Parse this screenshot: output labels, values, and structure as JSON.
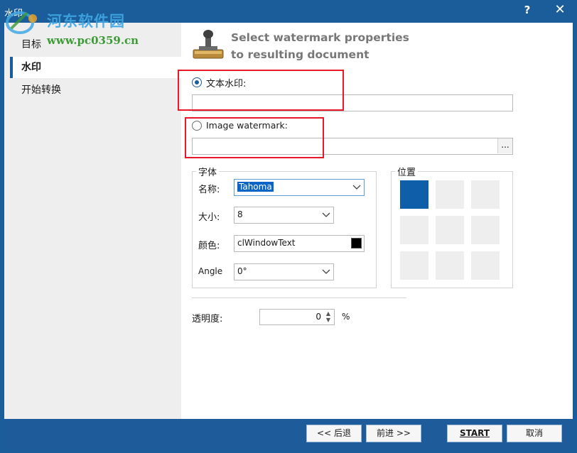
{
  "window": {
    "title": "水印",
    "help_label": "?",
    "close_label": "✕"
  },
  "overlay_watermark": {
    "name": "河东软件园",
    "url": "www.pc0359.cn"
  },
  "sidebar": {
    "items": [
      {
        "label": "目标",
        "active": false
      },
      {
        "label": "水印",
        "active": true
      },
      {
        "label": "开始转换",
        "active": false
      }
    ]
  },
  "main": {
    "heading_line1": "Select watermark properties",
    "heading_line2": "to resulting document",
    "text_watermark": {
      "label": "文本水印:",
      "value": "",
      "selected": true
    },
    "image_watermark": {
      "label": "Image watermark:",
      "value": "",
      "selected": false,
      "browse_label": "..."
    },
    "font_group": {
      "title": "字体",
      "name_label": "名称:",
      "name_value": "Tahoma",
      "size_label": "大小:",
      "size_value": "8",
      "color_label": "颜色:",
      "color_value": "clWindowText",
      "angle_label": "Angle",
      "angle_value": "0°"
    },
    "position_group": {
      "title": "位置",
      "selected_cell": "top-left"
    },
    "opacity": {
      "label": "透明度:",
      "value": "0",
      "unit": "%"
    }
  },
  "footer": {
    "back_label": "<< 后退",
    "next_label": "前进 >>",
    "start_label": "START",
    "cancel_label": "取消"
  },
  "colors": {
    "accent": "#1a5d9a",
    "highlight_box": "#e8182a",
    "selected_position": "#0e5ea9"
  }
}
